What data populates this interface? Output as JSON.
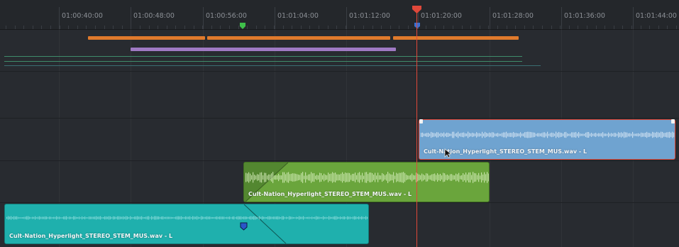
{
  "ruler": {
    "timecodes": [
      "01:00:40:00",
      "01:00:48:00",
      "01:00:56:00",
      "01:01:04:00",
      "01:01:12:00",
      "01:01:20:00",
      "01:01:28:00",
      "01:01:36:00",
      "01:01:44:00"
    ]
  },
  "clips": {
    "blue": {
      "name": "Cult-Nation_Hyperlight_STEREO_STEM_MUS.wav - L"
    },
    "green": {
      "name": "Cult-Nation_Hyperlight_STEREO_STEM_MUS.wav - L"
    },
    "teal": {
      "name": "Cult-Nation_Hyperlight_STEREO_STEM_MUS.wav - L"
    }
  },
  "colors": {
    "orange_bar": "#e07a2c",
    "purple_bar": "#a07ac4",
    "blue_clip": "#6fa3d0",
    "blue_clip_border": "#e0483a",
    "green_clip": "#6aa53c",
    "teal_clip": "#1fb0ad",
    "playhead": "#e0483a",
    "green_marker": "#3fbf4a",
    "blue_marker": "#3b6fd0"
  },
  "icons": {
    "playhead": "playhead-triangle-icon",
    "marker_green": "marker-icon",
    "marker_blue": "marker-icon",
    "keyframe": "keyframe-icon"
  }
}
